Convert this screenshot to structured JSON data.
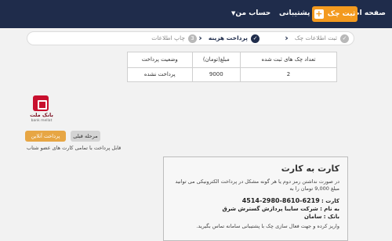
{
  "nav": {
    "home": "صفحه اصلی",
    "register_check": "ثبت چک",
    "plus_icon": "+",
    "support": "پشتیبانی",
    "account": "حساب من"
  },
  "stepper": {
    "step1": "ثبت اطلاعات چک",
    "step2": "پرداخت هزینه",
    "step3": "چاپ اطلاعات",
    "step3_num": "3"
  },
  "summary": {
    "headers": [
      "تعداد چک های ثبت شده",
      "مبلغ(تومان)",
      "وضعیت پرداخت"
    ],
    "row": [
      "2",
      "9000",
      "پرداخت نشده"
    ]
  },
  "bank": {
    "name_fa": "بانک ملت",
    "name_en": "bank mellat"
  },
  "buttons": {
    "prev": "مرحله قبلی",
    "pay_online": "پرداخت آنلاین"
  },
  "pay_note": "قابل پرداخت با تمامی کارت های عضو شتاب",
  "card_panel": {
    "title": "کارت به کارت",
    "description": "در صورت نداشتن رمز دوم یا هر گونه مشکل در پرداخت الکترونیکی می توانید مبلغ 9,000 تومان را به",
    "card_label": "کارت :",
    "card_number": "6219-8610-2980-4514",
    "name_label": "به نام :",
    "name_value": "شرکت سایبا پردازش گسترش شرق",
    "bank_label": "بانک :",
    "bank_value": "سامان",
    "footer": "واریز کرده و جهت فعال سازی چک با پشتیبانی سامانه تماس بگیرید."
  },
  "colors": {
    "topbar": "#1f2c4b",
    "accent": "#f39a1f",
    "pay_button": "#e7a644",
    "bank_red": "#c8102e"
  }
}
